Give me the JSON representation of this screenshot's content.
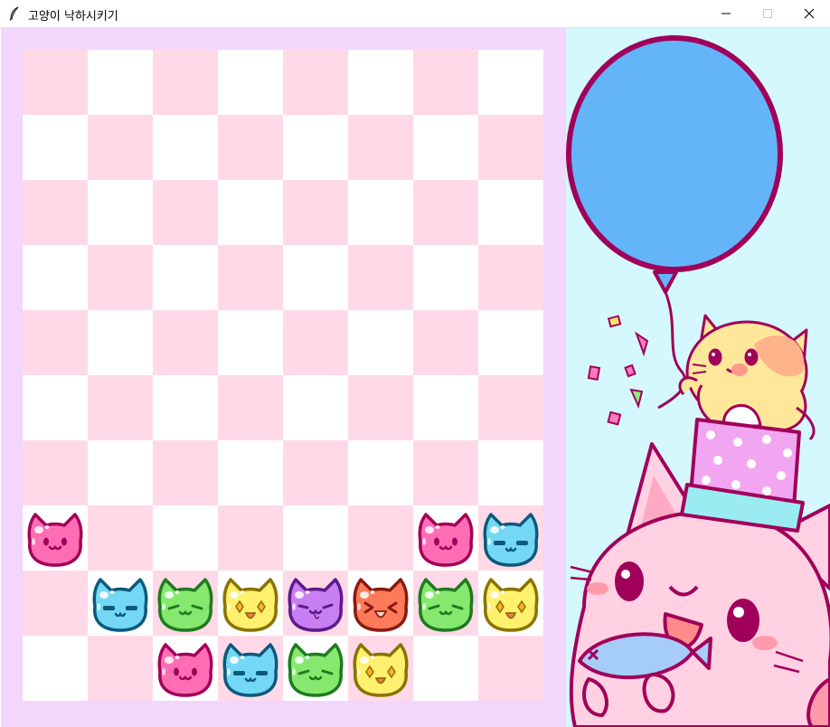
{
  "window": {
    "title": "고양이 낙하시키기",
    "icon": "feather-icon",
    "controls": [
      "minimize-icon",
      "maximize-icon",
      "close-icon"
    ]
  },
  "board": {
    "columns": 8,
    "rows": 10,
    "colors": {
      "checker_pink": "#ffd9e7",
      "checker_white": "#ffffff",
      "frame": "#f3d6fb",
      "side_background": "#d4f8fd"
    },
    "cat_types": {
      "pink": {
        "body": "#ff6eb4",
        "outline": "#a3005a",
        "face": "smile"
      },
      "blue": {
        "body": "#74d8f5",
        "outline": "#0c5a7a",
        "face": "sleepy"
      },
      "green": {
        "body": "#86e86e",
        "outline": "#1f7a1f",
        "face": "squint"
      },
      "yellow": {
        "body": "#fff06e",
        "outline": "#8a7200",
        "face": "sparkle"
      },
      "purple": {
        "body": "#c77ff2",
        "outline": "#5c1a86",
        "face": "tongue"
      },
      "red": {
        "body": "#ff7a5a",
        "outline": "#8a1a10",
        "face": "cry"
      }
    },
    "pieces": [
      {
        "row": 7,
        "col": 0,
        "type": "pink"
      },
      {
        "row": 7,
        "col": 6,
        "type": "pink"
      },
      {
        "row": 7,
        "col": 7,
        "type": "blue"
      },
      {
        "row": 8,
        "col": 1,
        "type": "blue"
      },
      {
        "row": 8,
        "col": 2,
        "type": "green"
      },
      {
        "row": 8,
        "col": 3,
        "type": "yellow"
      },
      {
        "row": 8,
        "col": 4,
        "type": "purple"
      },
      {
        "row": 8,
        "col": 5,
        "type": "red"
      },
      {
        "row": 8,
        "col": 6,
        "type": "green"
      },
      {
        "row": 8,
        "col": 7,
        "type": "yellow"
      },
      {
        "row": 9,
        "col": 2,
        "type": "pink"
      },
      {
        "row": 9,
        "col": 3,
        "type": "blue"
      },
      {
        "row": 9,
        "col": 4,
        "type": "green"
      },
      {
        "row": 9,
        "col": 5,
        "type": "yellow"
      }
    ]
  },
  "side_panel": {
    "illustration": "balloon-cats-illustration",
    "balloon_color": "#64b4fa",
    "outline_color": "#a0005a"
  }
}
